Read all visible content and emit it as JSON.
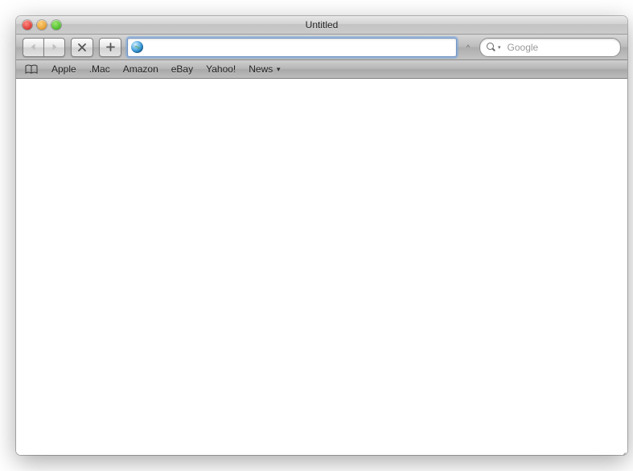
{
  "window": {
    "title": "Untitled"
  },
  "toolbar": {
    "address_value": "",
    "search_placeholder": "Google"
  },
  "bookmarks": {
    "items": [
      {
        "label": "Apple"
      },
      {
        "label": ".Mac"
      },
      {
        "label": "Amazon"
      },
      {
        "label": "eBay"
      },
      {
        "label": "Yahoo!"
      },
      {
        "label": "News",
        "dropdown": true
      }
    ]
  }
}
